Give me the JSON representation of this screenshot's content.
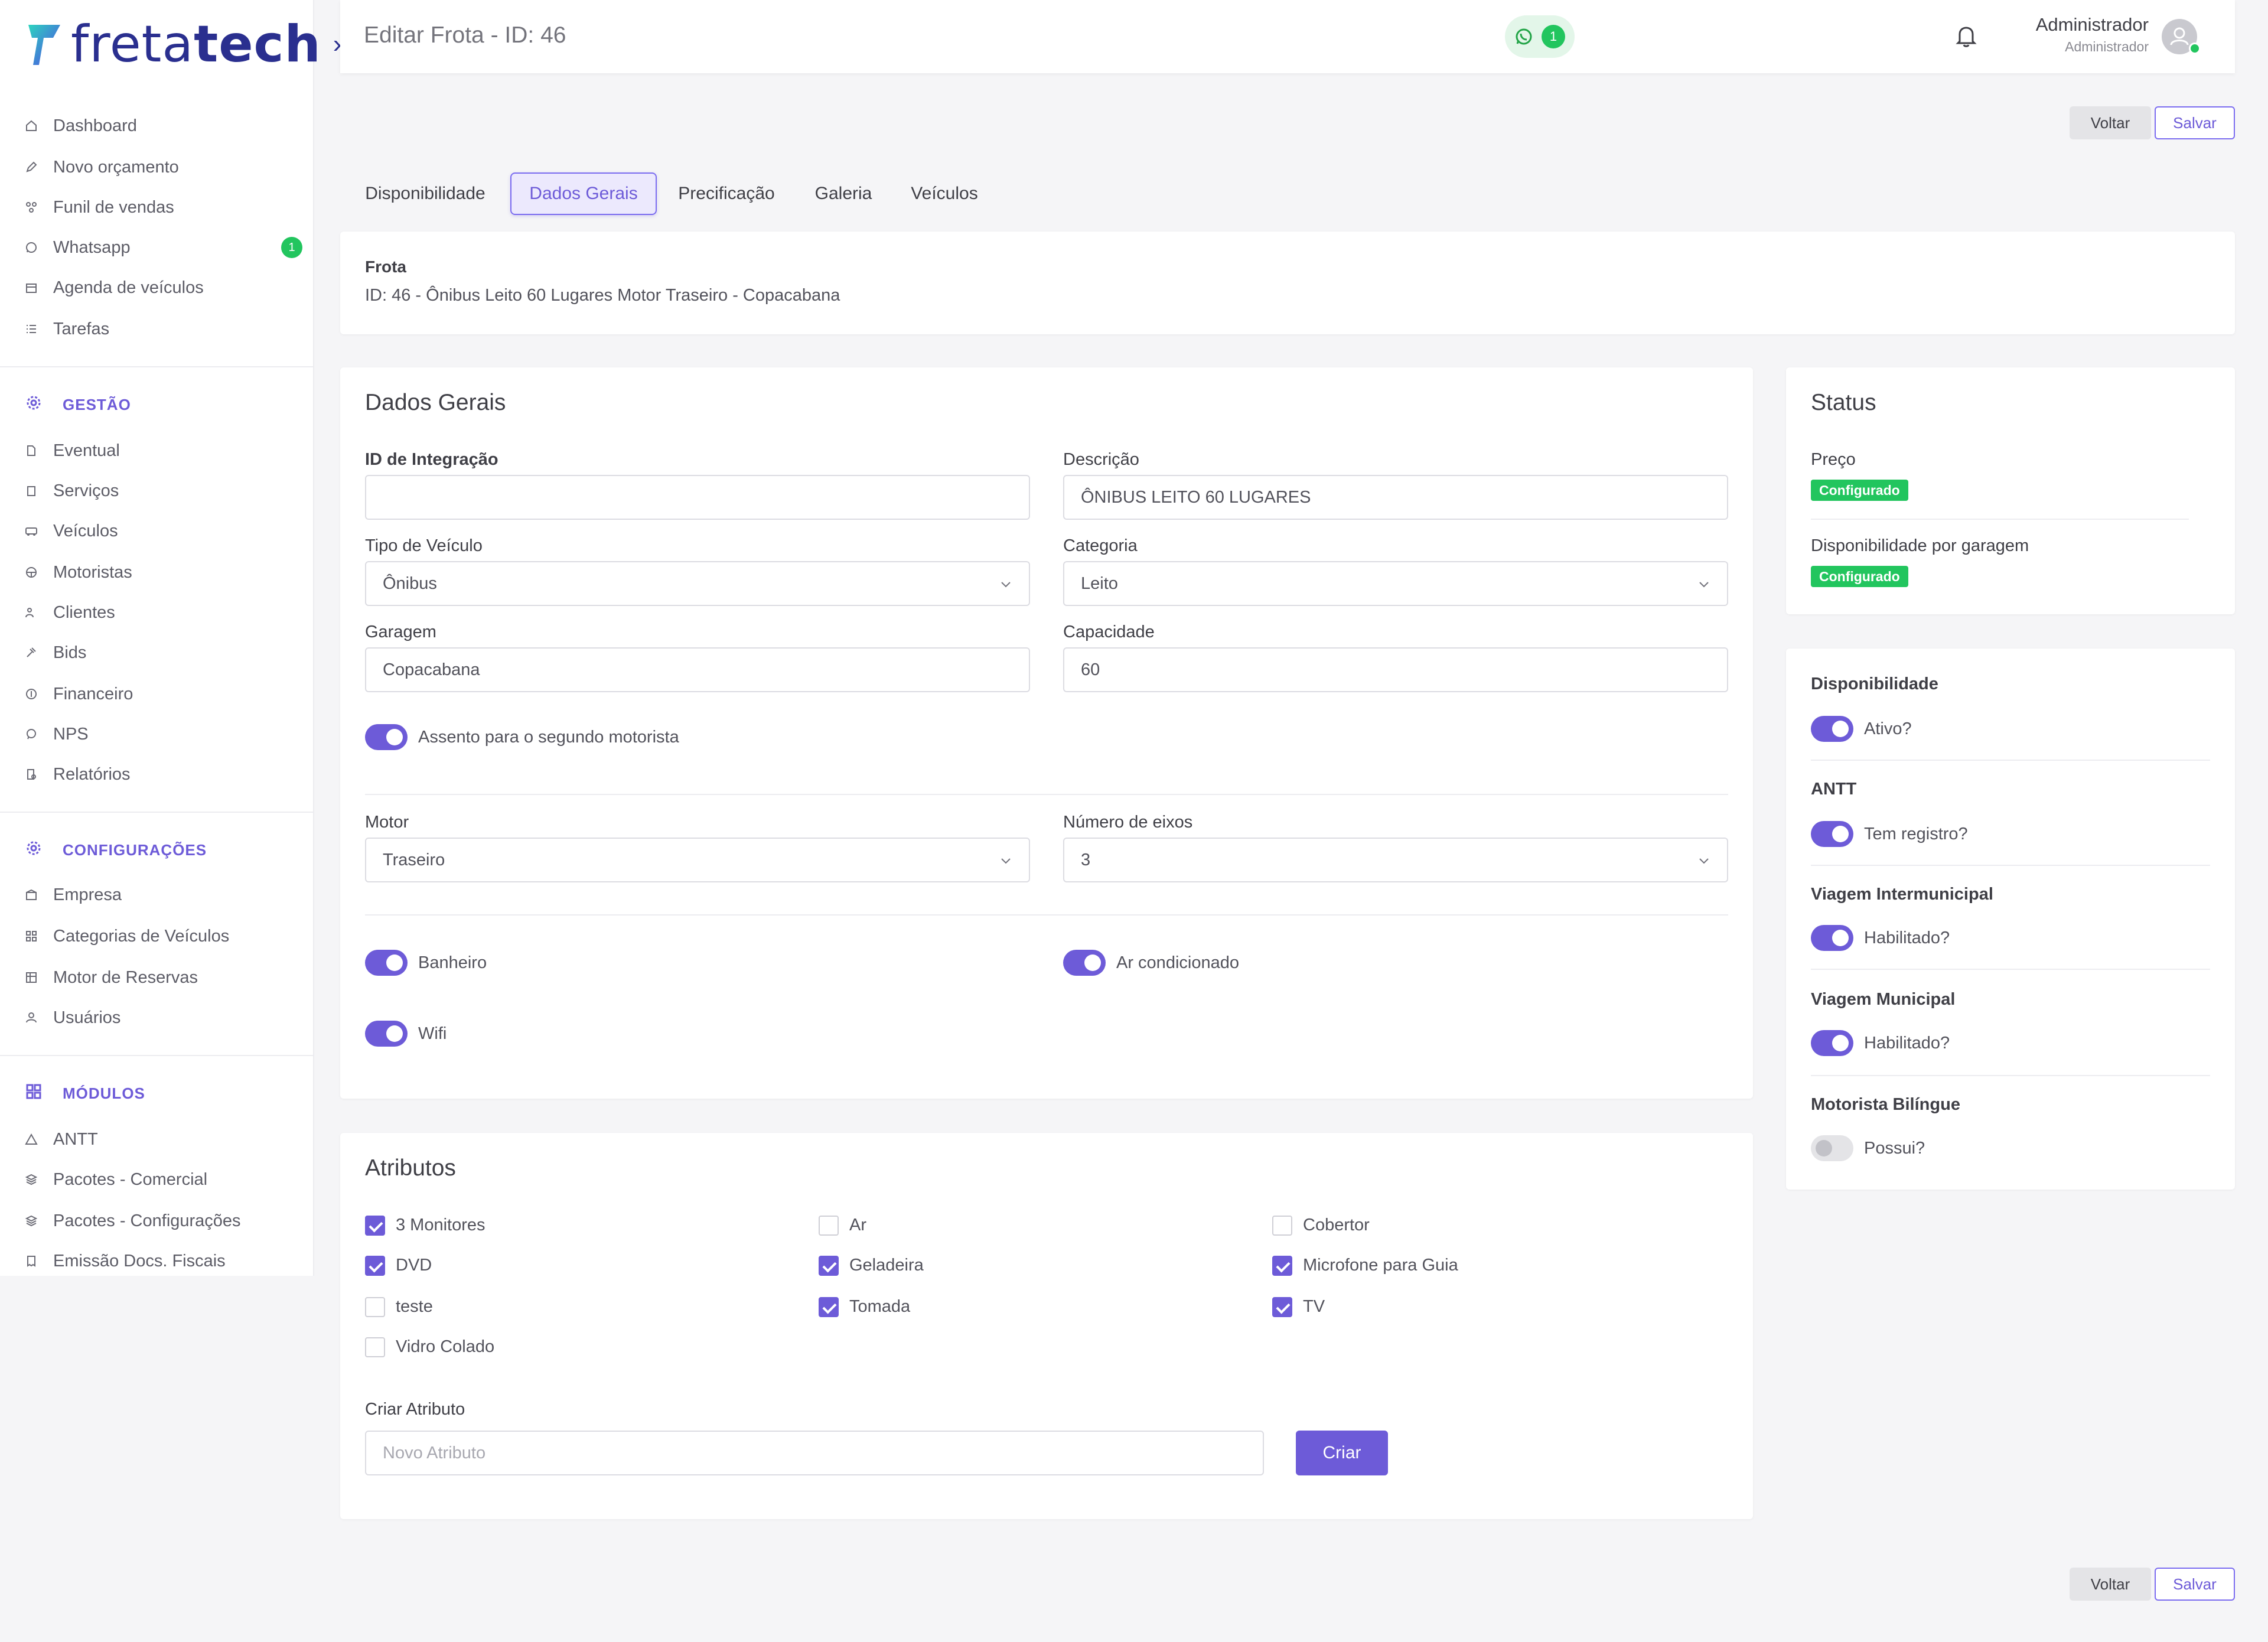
{
  "brand": {
    "name_light": "freta",
    "name_bold": "tech"
  },
  "sidebar": {
    "items": [
      {
        "label": "Dashboard",
        "icon": "home-icon"
      },
      {
        "label": "Novo orçamento",
        "icon": "edit-icon"
      },
      {
        "label": "Funil de vendas",
        "icon": "funnel-icon"
      },
      {
        "label": "Whatsapp",
        "icon": "whatsapp-icon",
        "badge": "1"
      },
      {
        "label": "Agenda de veículos",
        "icon": "calendar-icon"
      },
      {
        "label": "Tarefas",
        "icon": "list-icon"
      }
    ],
    "gestao": {
      "title": "GESTÃO",
      "items": [
        {
          "label": "Eventual"
        },
        {
          "label": "Serviços"
        },
        {
          "label": "Veículos"
        },
        {
          "label": "Motoristas"
        },
        {
          "label": "Clientes"
        },
        {
          "label": "Bids"
        },
        {
          "label": "Financeiro"
        },
        {
          "label": "NPS"
        },
        {
          "label": "Relatórios"
        }
      ]
    },
    "config": {
      "title": "CONFIGURAÇÕES",
      "items": [
        {
          "label": "Empresa"
        },
        {
          "label": "Categorias de Veículos"
        },
        {
          "label": "Motor de Reservas"
        },
        {
          "label": "Usuários"
        }
      ]
    },
    "modulos": {
      "title": "MÓDULOS",
      "items": [
        {
          "label": "ANTT"
        },
        {
          "label": "Pacotes - Comercial"
        },
        {
          "label": "Pacotes - Configurações"
        },
        {
          "label": "Emissão Docs. Fiscais"
        }
      ]
    }
  },
  "header": {
    "title": "Editar Frota - ID: 46",
    "whatsapp_count": "1",
    "user_name": "Administrador",
    "user_role": "Administrador"
  },
  "actions": {
    "back": "Voltar",
    "save": "Salvar"
  },
  "tabs": [
    "Disponibilidade",
    "Dados Gerais",
    "Precificação",
    "Galeria",
    "Veículos"
  ],
  "frota": {
    "label": "Frota",
    "value": "ID: 46 - Ônibus Leito 60 Lugares Motor Traseiro - Copacabana"
  },
  "dados_gerais": {
    "title": "Dados Gerais",
    "id_integracao": {
      "label": "ID de Integração",
      "value": ""
    },
    "descricao": {
      "label": "Descrição",
      "value": "ÔNIBUS LEITO 60 LUGARES"
    },
    "tipo_veiculo": {
      "label": "Tipo de Veículo",
      "value": "Ônibus"
    },
    "categoria": {
      "label": "Categoria",
      "value": "Leito"
    },
    "garagem": {
      "label": "Garagem",
      "value": "Copacabana"
    },
    "capacidade": {
      "label": "Capacidade",
      "value": "60"
    },
    "assento_label": "Assento para o segundo motorista",
    "motor": {
      "label": "Motor",
      "value": "Traseiro"
    },
    "eixos": {
      "label": "Número de eixos",
      "value": "3"
    },
    "banheiro": "Banheiro",
    "ar": "Ar condicionado",
    "wifi": "Wifi"
  },
  "atributos": {
    "title": "Atributos",
    "items": [
      {
        "label": "3 Monitores",
        "checked": true
      },
      {
        "label": "Ar",
        "checked": false
      },
      {
        "label": "Cobertor",
        "checked": false
      },
      {
        "label": "DVD",
        "checked": true
      },
      {
        "label": "Geladeira",
        "checked": true
      },
      {
        "label": "Microfone para Guia",
        "checked": true
      },
      {
        "label": "teste",
        "checked": false
      },
      {
        "label": "Tomada",
        "checked": true
      },
      {
        "label": "TV",
        "checked": true
      },
      {
        "label": "Vidro Colado",
        "checked": false
      }
    ],
    "criar_label": "Criar Atributo",
    "criar_placeholder": "Novo Atributo",
    "criar_button": "Criar"
  },
  "status": {
    "title": "Status",
    "preco": {
      "label": "Preço",
      "badge": "Configurado"
    },
    "disp_garagem": {
      "label": "Disponibilidade por garagem",
      "badge": "Configurado"
    }
  },
  "flags": {
    "disponibilidade": {
      "title": "Disponibilidade",
      "label": "Ativo?",
      "on": true
    },
    "antt": {
      "title": "ANTT",
      "label": "Tem registro?",
      "on": true
    },
    "intermunicipal": {
      "title": "Viagem Intermunicipal",
      "label": "Habilitado?",
      "on": true
    },
    "municipal": {
      "title": "Viagem Municipal",
      "label": "Habilitado?",
      "on": true
    },
    "bilingue": {
      "title": "Motorista Bilíngue",
      "label": "Possui?",
      "on": false
    }
  },
  "colors": {
    "accent": "#6d5bd8",
    "success": "#22c55e"
  }
}
